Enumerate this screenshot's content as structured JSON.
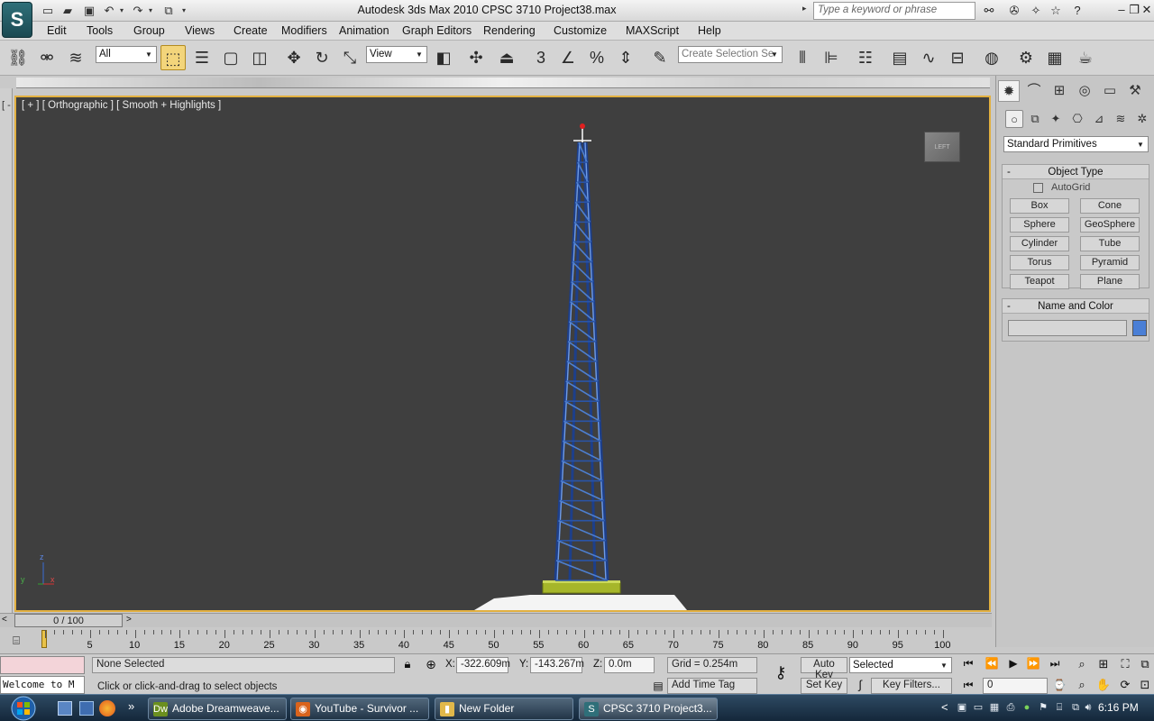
{
  "window": {
    "title": "Autodesk 3ds Max  2010       CPSC 3710 Project38.max",
    "search_placeholder": "Type a keyword or phrase"
  },
  "menu": {
    "items": [
      "Edit",
      "Tools",
      "Group",
      "Views",
      "Create",
      "Modifiers",
      "Animation",
      "Graph Editors",
      "Rendering",
      "Customize",
      "MAXScript",
      "Help"
    ]
  },
  "toolbar": {
    "filter_value": "All",
    "reference_coord_value": "View",
    "selection_set_placeholder": "Create Selection Se",
    "snap_label": "3"
  },
  "viewport": {
    "label": "[ + ] [ Orthographic ] [ Smooth + Highlights ]",
    "left_bracket": "[ -",
    "viewcube_label": "LEFT",
    "axis_z": "z",
    "axis_y": "y",
    "axis_x": "x"
  },
  "command_panel": {
    "primitives_dropdown": "Standard Primitives",
    "object_type": {
      "header": "Object Type",
      "collapse": "-",
      "autogrid_label": "AutoGrid",
      "buttons": [
        "Box",
        "Cone",
        "Sphere",
        "GeoSphere",
        "Cylinder",
        "Tube",
        "Torus",
        "Pyramid",
        "Teapot",
        "Plane"
      ]
    },
    "name_and_color": {
      "header": "Name and Color",
      "collapse": "-",
      "name_value": "",
      "color": "#4a7fd6"
    }
  },
  "time_slider": {
    "position": "0 / 100",
    "prev": "<",
    "next": ">",
    "ticks": [
      "0",
      "5",
      "10",
      "15",
      "20",
      "25",
      "30",
      "35",
      "40",
      "45",
      "50",
      "55",
      "60",
      "65",
      "70",
      "75",
      "80",
      "85",
      "90",
      "95",
      "100"
    ]
  },
  "status": {
    "maxscript_listener": "Welcome to M",
    "selection": "None Selected",
    "prompt": "Click or click-and-drag to select objects",
    "x_label": "X:",
    "x_value": "-322.609m",
    "y_label": "Y:",
    "y_value": "-143.267m",
    "z_label": "Z:",
    "z_value": "0.0m",
    "grid": "Grid = 0.254m",
    "add_time_tag": "Add Time Tag",
    "auto_key": "Auto Key",
    "set_key": "Set Key",
    "key_mode_value": "Selected",
    "key_filters": "Key Filters...",
    "frame_value": "0"
  },
  "taskbar": {
    "buttons": [
      {
        "label": "Adobe Dreamweave...",
        "icon": "Dw",
        "color": "#6b8f1f"
      },
      {
        "label": "YouTube - Survivor ...",
        "icon": "◉",
        "color": "#d9631c"
      },
      {
        "label": "New Folder",
        "icon": "▮",
        "color": "#e1b84a"
      },
      {
        "label": "CPSC 3710 Project3...",
        "icon": "S",
        "color": "#2f6f79"
      }
    ],
    "clock": "6:16 PM",
    "overflow": "»",
    "tray_expand": "<"
  }
}
